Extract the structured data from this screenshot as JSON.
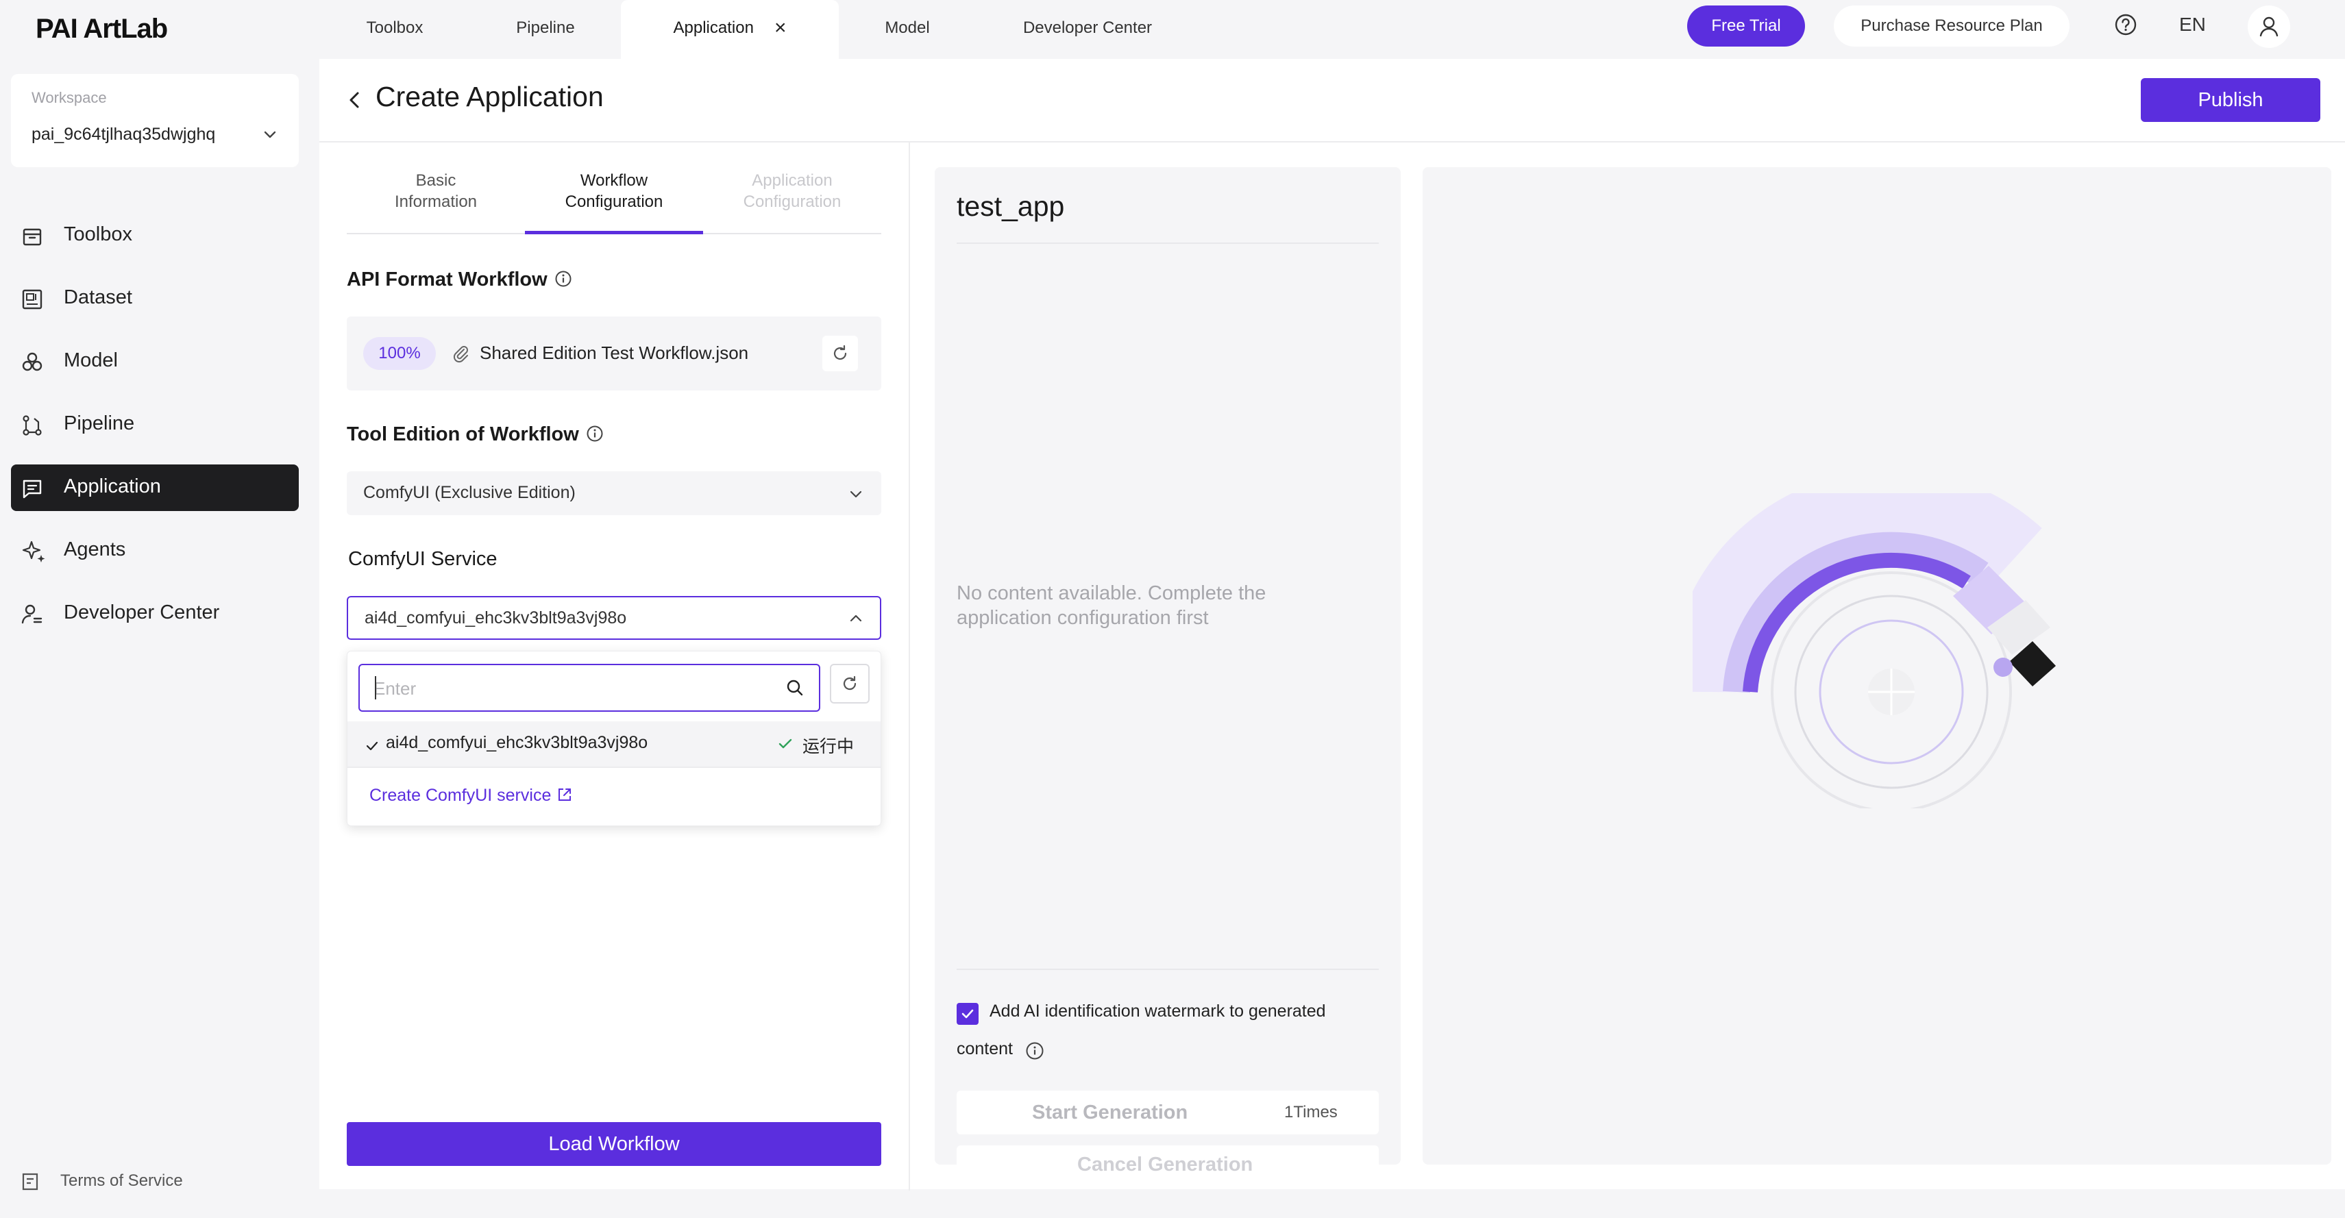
{
  "app": {
    "logo": "PAI ArtLab"
  },
  "topnav": {
    "tabs": [
      {
        "label": "Toolbox"
      },
      {
        "label": "Pipeline"
      },
      {
        "label": "Application"
      },
      {
        "label": "Model"
      },
      {
        "label": "Developer Center"
      }
    ],
    "close_glyph": "×",
    "free_trial": "Free Trial",
    "purchase_plan": "Purchase Resource Plan",
    "language": "EN"
  },
  "sidebar": {
    "workspace_label": "Workspace",
    "workspace_value": "pai_9c64tjlhaq35dwjghq",
    "items": [
      {
        "label": "Toolbox",
        "icon": "toolbox-icon"
      },
      {
        "label": "Dataset",
        "icon": "dataset-icon"
      },
      {
        "label": "Model",
        "icon": "model-icon"
      },
      {
        "label": "Pipeline",
        "icon": "pipeline-icon"
      },
      {
        "label": "Application",
        "icon": "application-icon"
      },
      {
        "label": "Agents",
        "icon": "agents-icon"
      },
      {
        "label": "Developer Center",
        "icon": "developer-center-icon"
      }
    ],
    "terms": "Terms of Service"
  },
  "header": {
    "title": "Create Application",
    "publish": "Publish"
  },
  "steps": [
    {
      "line1": "Basic",
      "line2": "Information"
    },
    {
      "line1": "Workflow",
      "line2": "Configuration"
    },
    {
      "line1": "Application",
      "line2": "Configuration"
    }
  ],
  "workflow": {
    "api_title": "API Format Workflow",
    "progress": "100%",
    "file_name": "Shared Edition Test Workflow.json",
    "edition_title": "Tool Edition of Workflow",
    "edition_value": "ComfyUI (Exclusive Edition)",
    "service_title": "ComfyUI Service",
    "service_value": "ai4d_comfyui_ehc3kv3blt9a3vj98o",
    "search_placeholder": "Enter",
    "options": [
      {
        "name": "ai4d_comfyui_ehc3kv3blt9a3vj98o",
        "status": "运行中"
      }
    ],
    "create_link": "Create ComfyUI service",
    "load_button": "Load Workflow"
  },
  "preview": {
    "app_name": "test_app",
    "empty_text": "No content available. Complete the application configuration first",
    "watermark_line1": "Add AI identification watermark to generated",
    "watermark_line2": "content",
    "start": "Start Generation",
    "count": "1Times",
    "cancel": "Cancel Generation"
  },
  "colors": {
    "accent": "#5b2ede",
    "active_nav": "#1e1e20"
  }
}
